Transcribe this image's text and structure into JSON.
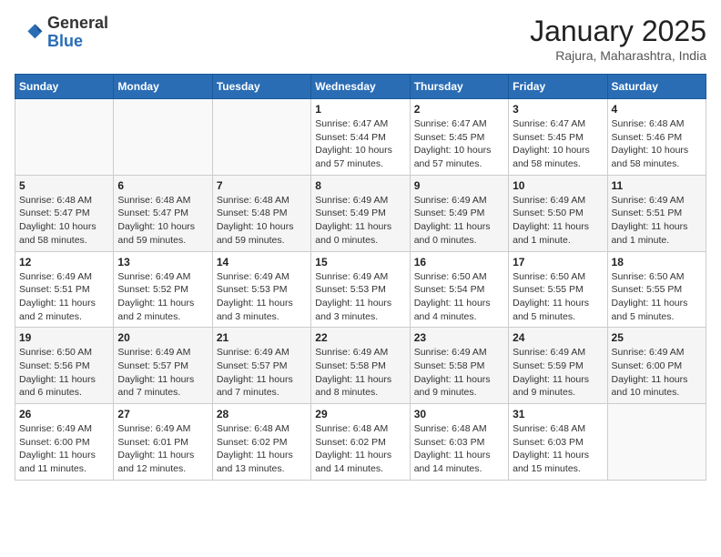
{
  "header": {
    "logo_general": "General",
    "logo_blue": "Blue",
    "month_title": "January 2025",
    "location": "Rajura, Maharashtra, India"
  },
  "days_of_week": [
    "Sunday",
    "Monday",
    "Tuesday",
    "Wednesday",
    "Thursday",
    "Friday",
    "Saturday"
  ],
  "weeks": [
    [
      {
        "day": "",
        "info": ""
      },
      {
        "day": "",
        "info": ""
      },
      {
        "day": "",
        "info": ""
      },
      {
        "day": "1",
        "info": "Sunrise: 6:47 AM\nSunset: 5:44 PM\nDaylight: 10 hours and 57 minutes."
      },
      {
        "day": "2",
        "info": "Sunrise: 6:47 AM\nSunset: 5:45 PM\nDaylight: 10 hours and 57 minutes."
      },
      {
        "day": "3",
        "info": "Sunrise: 6:47 AM\nSunset: 5:45 PM\nDaylight: 10 hours and 58 minutes."
      },
      {
        "day": "4",
        "info": "Sunrise: 6:48 AM\nSunset: 5:46 PM\nDaylight: 10 hours and 58 minutes."
      }
    ],
    [
      {
        "day": "5",
        "info": "Sunrise: 6:48 AM\nSunset: 5:47 PM\nDaylight: 10 hours and 58 minutes."
      },
      {
        "day": "6",
        "info": "Sunrise: 6:48 AM\nSunset: 5:47 PM\nDaylight: 10 hours and 59 minutes."
      },
      {
        "day": "7",
        "info": "Sunrise: 6:48 AM\nSunset: 5:48 PM\nDaylight: 10 hours and 59 minutes."
      },
      {
        "day": "8",
        "info": "Sunrise: 6:49 AM\nSunset: 5:49 PM\nDaylight: 11 hours and 0 minutes."
      },
      {
        "day": "9",
        "info": "Sunrise: 6:49 AM\nSunset: 5:49 PM\nDaylight: 11 hours and 0 minutes."
      },
      {
        "day": "10",
        "info": "Sunrise: 6:49 AM\nSunset: 5:50 PM\nDaylight: 11 hours and 1 minute."
      },
      {
        "day": "11",
        "info": "Sunrise: 6:49 AM\nSunset: 5:51 PM\nDaylight: 11 hours and 1 minute."
      }
    ],
    [
      {
        "day": "12",
        "info": "Sunrise: 6:49 AM\nSunset: 5:51 PM\nDaylight: 11 hours and 2 minutes."
      },
      {
        "day": "13",
        "info": "Sunrise: 6:49 AM\nSunset: 5:52 PM\nDaylight: 11 hours and 2 minutes."
      },
      {
        "day": "14",
        "info": "Sunrise: 6:49 AM\nSunset: 5:53 PM\nDaylight: 11 hours and 3 minutes."
      },
      {
        "day": "15",
        "info": "Sunrise: 6:49 AM\nSunset: 5:53 PM\nDaylight: 11 hours and 3 minutes."
      },
      {
        "day": "16",
        "info": "Sunrise: 6:50 AM\nSunset: 5:54 PM\nDaylight: 11 hours and 4 minutes."
      },
      {
        "day": "17",
        "info": "Sunrise: 6:50 AM\nSunset: 5:55 PM\nDaylight: 11 hours and 5 minutes."
      },
      {
        "day": "18",
        "info": "Sunrise: 6:50 AM\nSunset: 5:55 PM\nDaylight: 11 hours and 5 minutes."
      }
    ],
    [
      {
        "day": "19",
        "info": "Sunrise: 6:50 AM\nSunset: 5:56 PM\nDaylight: 11 hours and 6 minutes."
      },
      {
        "day": "20",
        "info": "Sunrise: 6:49 AM\nSunset: 5:57 PM\nDaylight: 11 hours and 7 minutes."
      },
      {
        "day": "21",
        "info": "Sunrise: 6:49 AM\nSunset: 5:57 PM\nDaylight: 11 hours and 7 minutes."
      },
      {
        "day": "22",
        "info": "Sunrise: 6:49 AM\nSunset: 5:58 PM\nDaylight: 11 hours and 8 minutes."
      },
      {
        "day": "23",
        "info": "Sunrise: 6:49 AM\nSunset: 5:58 PM\nDaylight: 11 hours and 9 minutes."
      },
      {
        "day": "24",
        "info": "Sunrise: 6:49 AM\nSunset: 5:59 PM\nDaylight: 11 hours and 9 minutes."
      },
      {
        "day": "25",
        "info": "Sunrise: 6:49 AM\nSunset: 6:00 PM\nDaylight: 11 hours and 10 minutes."
      }
    ],
    [
      {
        "day": "26",
        "info": "Sunrise: 6:49 AM\nSunset: 6:00 PM\nDaylight: 11 hours and 11 minutes."
      },
      {
        "day": "27",
        "info": "Sunrise: 6:49 AM\nSunset: 6:01 PM\nDaylight: 11 hours and 12 minutes."
      },
      {
        "day": "28",
        "info": "Sunrise: 6:48 AM\nSunset: 6:02 PM\nDaylight: 11 hours and 13 minutes."
      },
      {
        "day": "29",
        "info": "Sunrise: 6:48 AM\nSunset: 6:02 PM\nDaylight: 11 hours and 14 minutes."
      },
      {
        "day": "30",
        "info": "Sunrise: 6:48 AM\nSunset: 6:03 PM\nDaylight: 11 hours and 14 minutes."
      },
      {
        "day": "31",
        "info": "Sunrise: 6:48 AM\nSunset: 6:03 PM\nDaylight: 11 hours and 15 minutes."
      },
      {
        "day": "",
        "info": ""
      }
    ]
  ]
}
